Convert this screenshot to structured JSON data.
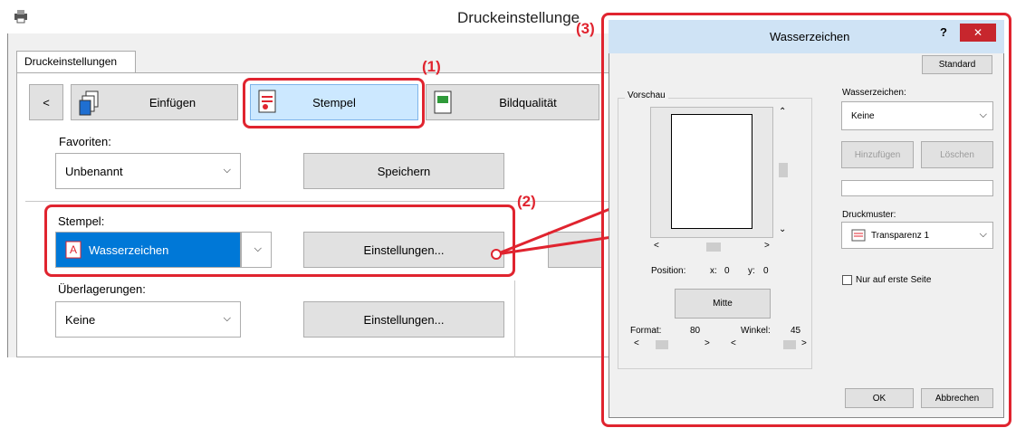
{
  "main": {
    "title": "Druckeinstellunge",
    "tab": "Druckeinstellungen",
    "nav_prev": "<",
    "tabs": [
      "Einfügen",
      "Stempel",
      "Bildqualität"
    ],
    "favorites_label": "Favoriten:",
    "favorites_value": "Unbenannt",
    "save_button": "Speichern",
    "stamp_label": "Stempel:",
    "stamp_value": "Wasserzeichen",
    "settings_button": "Einstellungen...",
    "overlays_label": "Überlagerungen:",
    "overlays_value": "Keine",
    "settings_button_2": "Einstellungen..."
  },
  "callouts": {
    "c1": "(1)",
    "c2": "(2)",
    "c3": "(3)"
  },
  "dialog": {
    "title": "Wasserzeichen",
    "help": "?",
    "close": "✕",
    "standard_button": "Standard",
    "preview_label": "Vorschau",
    "position_label": "Position:",
    "x_label": "x:",
    "x_value": "0",
    "y_label": "y:",
    "y_value": "0",
    "center_button": "Mitte",
    "format_label": "Format:",
    "format_value": "80",
    "angle_label": "Winkel:",
    "angle_value": "45",
    "watermark_label": "Wasserzeichen:",
    "watermark_value": "Keine",
    "add_button": "Hinzufügen",
    "delete_button": "Löschen",
    "pattern_label": "Druckmuster:",
    "pattern_value": "Transparenz 1",
    "first_page_label": "Nur auf erste Seite",
    "ok_button": "OK",
    "cancel_button": "Abbrechen"
  },
  "colors": {
    "accent": "#e0242f",
    "selected": "#0078d7",
    "tab_highlight": "#cce8ff"
  }
}
